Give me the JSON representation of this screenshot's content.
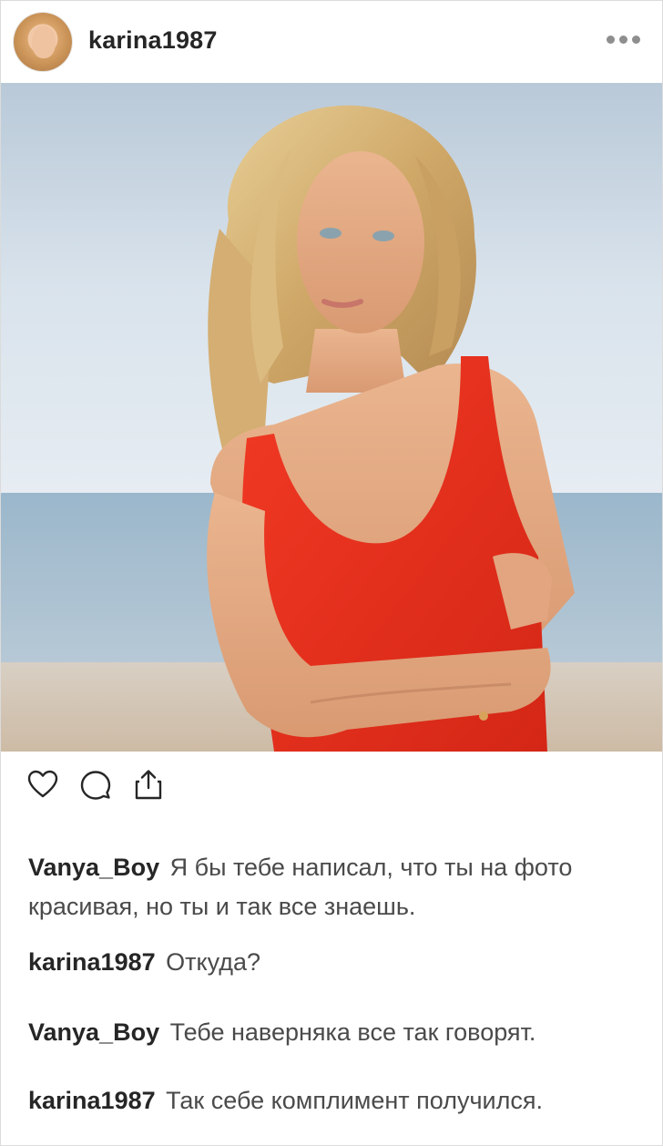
{
  "post": {
    "author": "karina1987",
    "more_icon": "more-horizontal-icon"
  },
  "actions": {
    "like_icon": "heart-icon",
    "comment_icon": "comment-bubble-icon",
    "share_icon": "share-icon"
  },
  "comments": [
    {
      "author": "Vanya_Boy",
      "text": "Я бы тебе написал, что ты на фото красивая, но ты и так все знаешь."
    },
    {
      "author": "karina1987",
      "text": "Откуда?"
    },
    {
      "author": "Vanya_Boy",
      "text": "Тебе наверняка все так говорят."
    },
    {
      "author": "karina1987",
      "text": "Так себе комплимент получился."
    }
  ],
  "colors": {
    "swimsuit": "#e8321f",
    "sky": "#c9d9e6",
    "sea": "#8fb0c6",
    "sand": "#d9cbb8"
  }
}
